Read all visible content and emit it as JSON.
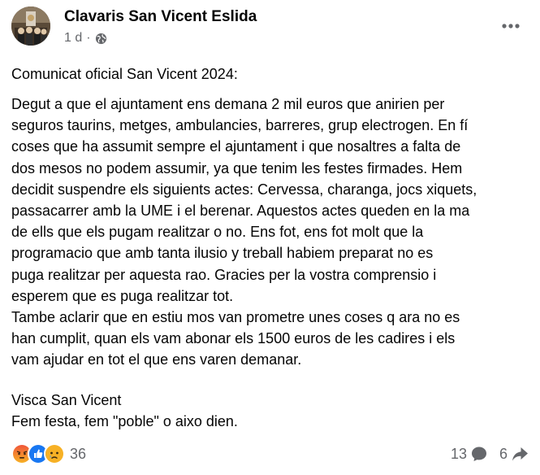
{
  "post": {
    "author": "Clavaris San Vicent Eslida",
    "time": "1 d",
    "separator": "·",
    "intro": "Comunicat oficial San Vicent 2024:",
    "body_lines": [
      "Degut a que el ajuntament ens demana 2 mil euros que anirien per",
      "seguros taurins, metges, ambulancies, barreres, grup electrogen. En fí",
      "coses que ha assumit sempre el ajuntament i que nosaltres a falta de",
      "dos mesos no podem assumir, ya que tenim les festes firmades. Hem",
      "decidit suspendre els siguients actes: Cervessa, charanga, jocs xiquets,",
      "passacarrer amb la UME i el berenar. Aquestos actes queden en la ma",
      "de ells que els pugam realitzar o no. Ens fot, ens fot molt que la",
      "programacio que amb tanta ilusio y treball habiem preparat no es",
      "puga realitzar per aquesta rao. Gracies per la vostra comprensio i",
      "esperem que es puga realitzar tot.",
      "Tambe aclarir que en estiu mos van prometre unes coses q ara no es",
      "han cumplit, quan els vam abonar els 1500 euros de les cadires i els",
      "vam ajudar en tot el que ens varen demanar."
    ],
    "signoff_lines": [
      "Visca San Vicent",
      "Fem festa, fem \"poble\" o aixo dien."
    ]
  },
  "footer": {
    "reactions": [
      "angry-icon",
      "like-icon",
      "sad-icon"
    ],
    "reaction_count": "36",
    "comment_count": "13",
    "share_count": "6"
  },
  "icons": {
    "privacy": "globe-icon",
    "more": "more-options-icon",
    "comment": "comment-icon",
    "share": "share-icon"
  },
  "colors": {
    "text": "#050505",
    "secondary": "#65676b",
    "like": "#1877f2",
    "angry": "#e9710f",
    "sad": "#f7b125"
  }
}
